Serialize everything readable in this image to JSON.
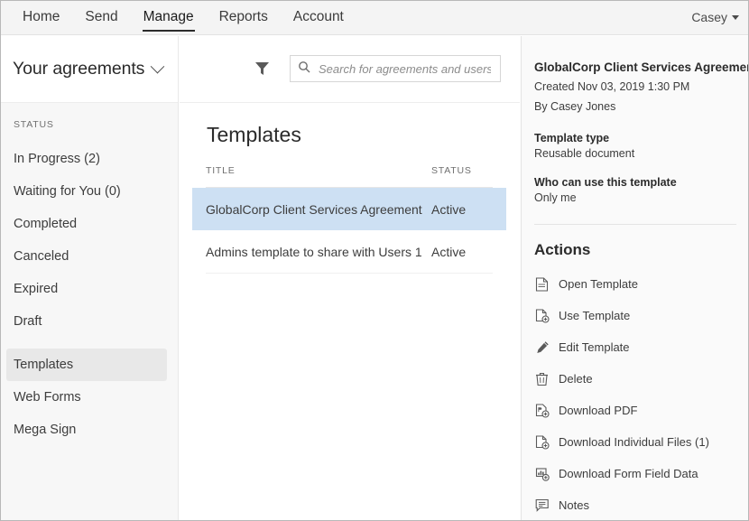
{
  "topnav": {
    "items": [
      {
        "label": "Home",
        "active": false
      },
      {
        "label": "Send",
        "active": false
      },
      {
        "label": "Manage",
        "active": true
      },
      {
        "label": "Reports",
        "active": false
      },
      {
        "label": "Account",
        "active": false
      }
    ],
    "user": "Casey"
  },
  "sidebar": {
    "header_title": "Your agreements",
    "status_label": "STATUS",
    "items": [
      {
        "label": "In Progress (2)",
        "selected": false
      },
      {
        "label": "Waiting for You (0)",
        "selected": false
      },
      {
        "label": "Completed",
        "selected": false
      },
      {
        "label": "Canceled",
        "selected": false
      },
      {
        "label": "Expired",
        "selected": false
      },
      {
        "label": "Draft",
        "selected": false
      },
      {
        "label": "Templates",
        "selected": true
      },
      {
        "label": "Web Forms",
        "selected": false
      },
      {
        "label": "Mega Sign",
        "selected": false
      }
    ]
  },
  "toolbar": {
    "filter_icon": "filter-icon",
    "search_icon": "search-icon",
    "search_placeholder": "Search for agreements and users...",
    "search_value": ""
  },
  "main": {
    "page_title": "Templates",
    "columns": [
      {
        "key": "title",
        "label": "TITLE"
      },
      {
        "key": "status",
        "label": "STATUS"
      }
    ],
    "rows": [
      {
        "title": "GlobalCorp Client Services Agreement",
        "status": "Active",
        "selected": true
      },
      {
        "title": "Admins template to share with Users 1",
        "status": "Active",
        "selected": false
      }
    ]
  },
  "details": {
    "doc_title": "GlobalCorp Client Services Agreement",
    "created": "Created Nov 03, 2019 1:30 PM",
    "author": "By Casey Jones",
    "template_type_label": "Template type",
    "template_type_value": "Reusable document",
    "who_can_use_label": "Who can use this template",
    "who_can_use_value": "Only me",
    "actions_title": "Actions",
    "actions": [
      {
        "label": "Open Template",
        "icon": "document-icon"
      },
      {
        "label": "Use Template",
        "icon": "document-add-icon"
      },
      {
        "label": "Edit Template",
        "icon": "pencil-icon"
      },
      {
        "label": "Delete",
        "icon": "trash-icon"
      },
      {
        "label": "Download PDF",
        "icon": "pdf-download-icon"
      },
      {
        "label": "Download Individual Files (1)",
        "icon": "file-download-icon"
      },
      {
        "label": "Download Form Field Data",
        "icon": "chart-download-icon"
      },
      {
        "label": "Notes",
        "icon": "speech-bubble-icon"
      }
    ]
  },
  "colors": {
    "selected_row": "#cde0f3",
    "nav_bar": "#f4f4f4",
    "sidebar": "#f7f7f7",
    "right_panel": "#fafafa",
    "text": "#3d3d3d"
  }
}
